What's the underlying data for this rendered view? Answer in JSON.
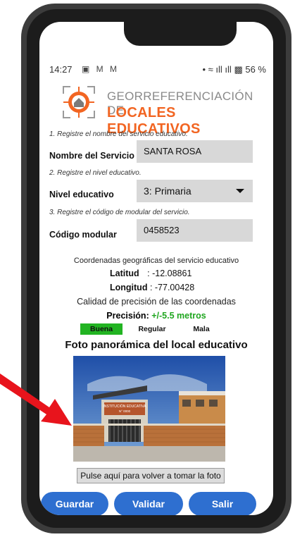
{
  "status_bar": {
    "time": "14:27",
    "icons": "▣ M M",
    "network": "• ≈ ıll ıll",
    "battery": "56 %"
  },
  "header": {
    "line1": "GEORREFERENCIACIÓN DE",
    "line2": "LOCALES EDUCATIVOS"
  },
  "form": {
    "step1": "1. Registre el nombre del servicio educativo.",
    "nombre_label": "Nombre del Servicio",
    "nombre_value": "SANTA ROSA",
    "step2": "2. Registre el nivel educativo.",
    "nivel_label": "Nivel educativo",
    "nivel_value": "3: Primaria",
    "step3": "3. Registre el código de modular del servicio.",
    "codigo_label": "Código modular",
    "codigo_value": "0458523"
  },
  "coords": {
    "title": "Coordenadas geográficas del servicio educativo",
    "lat_label": "Latitud",
    "lat_value": ": -12.08861",
    "lng_label": "Longitud",
    "lng_value": ": -77.00428",
    "calidad": "Calidad de precisión de las coordenadas",
    "precision_label": "Precisión:",
    "precision_value": "+/-5.5 metros",
    "quality_good": "Buena",
    "quality_regular": "Regular",
    "quality_bad": "Mala",
    "quality_selected_color": "#22b422"
  },
  "photo": {
    "title": "Foto panorámica del local educativo",
    "sign": "INSTITUCIÓN EDUCATIVA",
    "sign_number": "N° 0000",
    "retake_label": "Pulse aquí para volver a tomar la foto"
  },
  "buttons": {
    "save": "Guardar",
    "validate": "Validar",
    "exit": "Salir"
  },
  "colors": {
    "accent_orange": "#f26522",
    "button_blue": "#2e6fd0",
    "precision_green": "#1fa61f",
    "arrow_red": "#e8141c"
  }
}
